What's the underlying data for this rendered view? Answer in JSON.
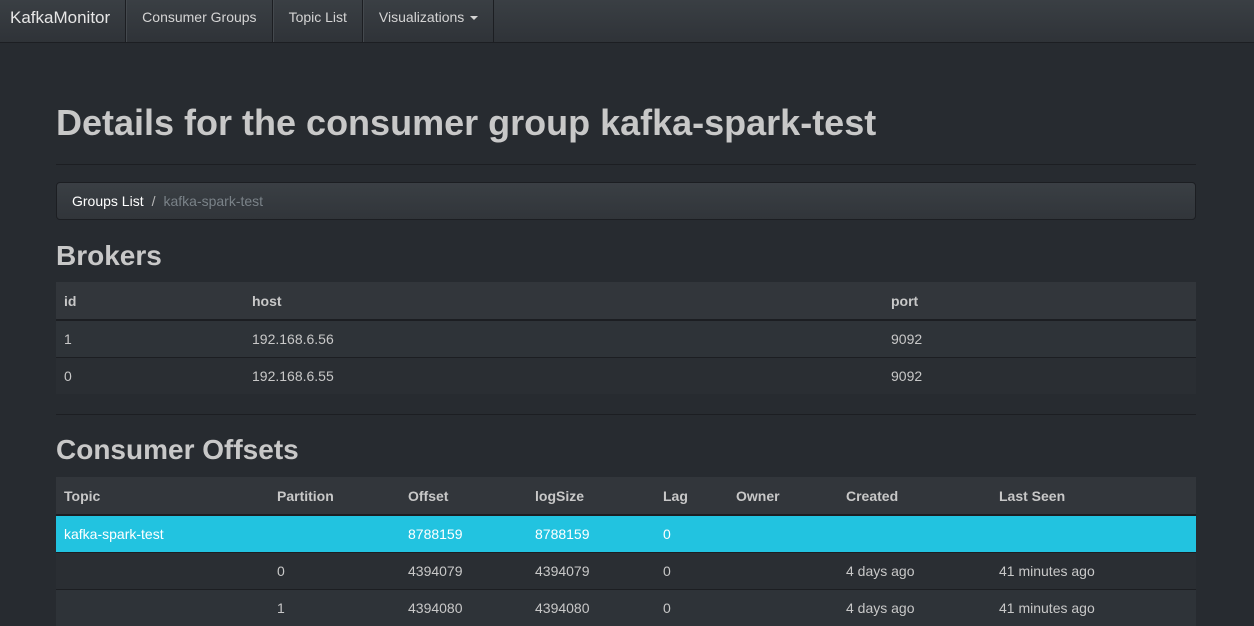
{
  "navbar": {
    "brand": "KafkaMonitor",
    "items": [
      "Consumer Groups",
      "Topic List",
      "Visualizations"
    ]
  },
  "page_title": "Details for the consumer group kafka-spark-test",
  "breadcrumb": {
    "link": "Groups List",
    "separator": "/",
    "active": "kafka-spark-test"
  },
  "brokers": {
    "title": "Brokers",
    "headers": [
      "id",
      "host",
      "port"
    ],
    "rows": [
      [
        "1",
        "192.168.6.56",
        "9092"
      ],
      [
        "0",
        "192.168.6.55",
        "9092"
      ]
    ]
  },
  "offsets": {
    "title": "Consumer Offsets",
    "headers": [
      "Topic",
      "Partition",
      "Offset",
      "logSize",
      "Lag",
      "Owner",
      "Created",
      "Last Seen"
    ],
    "rows": [
      [
        "kafka-spark-test",
        "",
        "8788159",
        "8788159",
        "0",
        "",
        "",
        ""
      ],
      [
        "",
        "0",
        "4394079",
        "4394079",
        "0",
        "",
        "4 days ago",
        "41 minutes ago"
      ],
      [
        "",
        "1",
        "4394080",
        "4394080",
        "0",
        "",
        "4 days ago",
        "41 minutes ago"
      ]
    ]
  },
  "colors": {
    "highlight": "#22c3e0",
    "background": "#272b30"
  }
}
